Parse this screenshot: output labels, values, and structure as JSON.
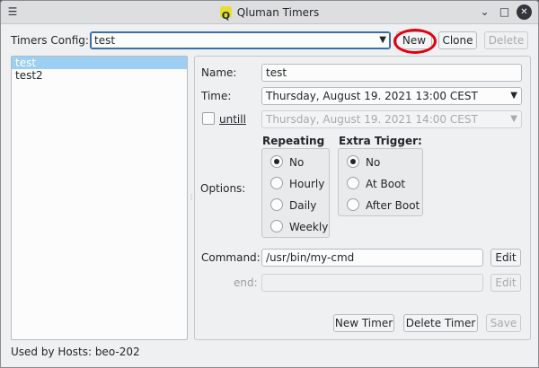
{
  "window": {
    "title": "Qluman Timers"
  },
  "toolbar": {
    "config_label": "Timers Config:",
    "config_value": "test",
    "new_label": "New",
    "clone_label": "Clone",
    "delete_label": "Delete"
  },
  "list": {
    "items": [
      "test",
      "test2"
    ]
  },
  "form": {
    "name_label": "Name:",
    "name_value": "test",
    "time_label": "Time:",
    "time_value": "Thursday, August 19. 2021 13:00 CEST",
    "until_label": "untill",
    "until_value": "Thursday, August 19. 2021 14:00 CEST",
    "options_label": "Options:",
    "repeating_title": "Repeating",
    "repeating_options": [
      "No",
      "Hourly",
      "Daily",
      "Weekly"
    ],
    "trigger_title": "Extra Trigger:",
    "trigger_options": [
      "No",
      "At Boot",
      "After Boot"
    ],
    "command_label": "Command:",
    "command_value": "/usr/bin/my-cmd",
    "edit_label": "Edit",
    "end_label": "end:",
    "end_value": "",
    "new_timer_label": "New Timer",
    "delete_timer_label": "Delete Timer",
    "save_label": "Save"
  },
  "footer": {
    "used_by": "Used by Hosts: beo-202"
  }
}
